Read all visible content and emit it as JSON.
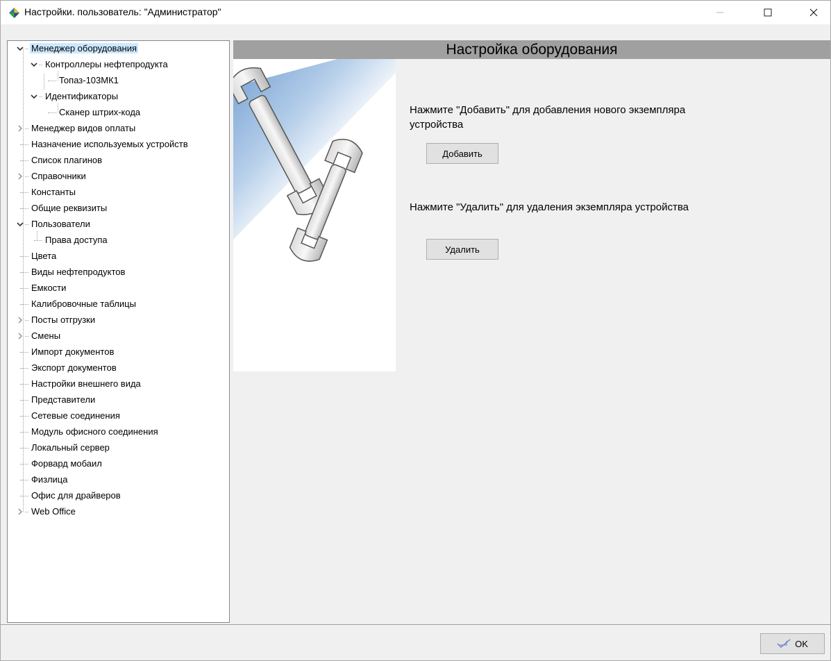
{
  "window": {
    "title": "Настройки. пользователь: \"Администратор\""
  },
  "tree": {
    "items": [
      {
        "label": "Менеджер оборудования",
        "level": 0,
        "expander": "expanded",
        "selected": true
      },
      {
        "label": "Контроллеры нефтепродукта",
        "level": 1,
        "expander": "expanded"
      },
      {
        "label": "Топаз-103МК1",
        "level": 2,
        "expander": "none"
      },
      {
        "label": "Идентификаторы",
        "level": 1,
        "expander": "expanded"
      },
      {
        "label": "Сканер штрих-кода",
        "level": 2,
        "expander": "none"
      },
      {
        "label": "Менеджер видов оплаты",
        "level": 0,
        "expander": "collapsed"
      },
      {
        "label": "Назначение используемых устройств",
        "level": 0,
        "expander": "none"
      },
      {
        "label": "Список плагинов",
        "level": 0,
        "expander": "none"
      },
      {
        "label": "Справочники",
        "level": 0,
        "expander": "collapsed"
      },
      {
        "label": "Константы",
        "level": 0,
        "expander": "none"
      },
      {
        "label": "Общие реквизиты",
        "level": 0,
        "expander": "none"
      },
      {
        "label": "Пользователи",
        "level": 0,
        "expander": "expanded"
      },
      {
        "label": "Права доступа",
        "level": 1,
        "expander": "none"
      },
      {
        "label": "Цвета",
        "level": 0,
        "expander": "none"
      },
      {
        "label": "Виды нефтепродуктов",
        "level": 0,
        "expander": "none"
      },
      {
        "label": "Емкости",
        "level": 0,
        "expander": "none"
      },
      {
        "label": "Калибровочные таблицы",
        "level": 0,
        "expander": "none"
      },
      {
        "label": "Посты отгрузки",
        "level": 0,
        "expander": "collapsed"
      },
      {
        "label": "Смены",
        "level": 0,
        "expander": "collapsed"
      },
      {
        "label": "Импорт документов",
        "level": 0,
        "expander": "none"
      },
      {
        "label": "Экспорт документов",
        "level": 0,
        "expander": "none"
      },
      {
        "label": "Настройки внешнего вида",
        "level": 0,
        "expander": "none"
      },
      {
        "label": "Представители",
        "level": 0,
        "expander": "none"
      },
      {
        "label": "Сетевые соединения",
        "level": 0,
        "expander": "none"
      },
      {
        "label": "Модуль офисного соединения",
        "level": 0,
        "expander": "none"
      },
      {
        "label": "Локальный сервер",
        "level": 0,
        "expander": "none"
      },
      {
        "label": "Форвард мобаил",
        "level": 0,
        "expander": "none"
      },
      {
        "label": "Физлица",
        "level": 0,
        "expander": "none"
      },
      {
        "label": "Офис для драйверов",
        "level": 0,
        "expander": "none"
      },
      {
        "label": "Web Office",
        "level": 0,
        "expander": "collapsed"
      }
    ]
  },
  "panel": {
    "header": "Настройка оборудования",
    "image_icon": "wrenches-icon",
    "add_instruction": "Нажмите \"Добавить\" для добавления нового экземпляра устройства",
    "add_button": "Добавить",
    "delete_instruction": "Нажмите \"Удалить\" для удаления экземпляра устройства",
    "delete_button": "Удалить"
  },
  "footer": {
    "ok_label": "OK",
    "ok_icon": "checkmark-icon"
  },
  "colors": {
    "selection": "#cce8ff",
    "header_bar": "#a0a0a0",
    "window_bg": "#f0f0f0"
  }
}
